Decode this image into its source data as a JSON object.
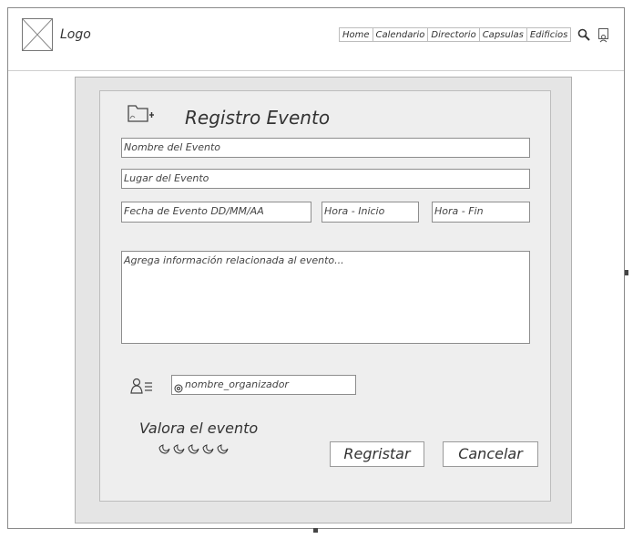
{
  "header": {
    "logo_label": "Logo",
    "nav": [
      "Home",
      "Calendario",
      "Directorio",
      "Capsulas",
      "Edificios"
    ],
    "icons": [
      "search-icon",
      "user-icon"
    ]
  },
  "form": {
    "title": "Registro Evento",
    "title_icon": "folder-add-icon",
    "event_name_placeholder": "Nombre del Evento",
    "event_place_placeholder": "Lugar del Evento",
    "event_date_placeholder": "Fecha de Evento  DD/MM/AA",
    "start_time_placeholder": "Hora - Inicio",
    "end_time_placeholder": "Hora - Fin",
    "info_placeholder": "Agrega información relacionada al evento...",
    "organizer_icon": "user-list-icon",
    "organizer_value": "nombre_organizador",
    "rating_label": "Valora el evento",
    "rating": {
      "value": 0,
      "max": 5,
      "icon": "moon-icon"
    },
    "register_button": "Regristar",
    "cancel_button": "Cancelar"
  }
}
